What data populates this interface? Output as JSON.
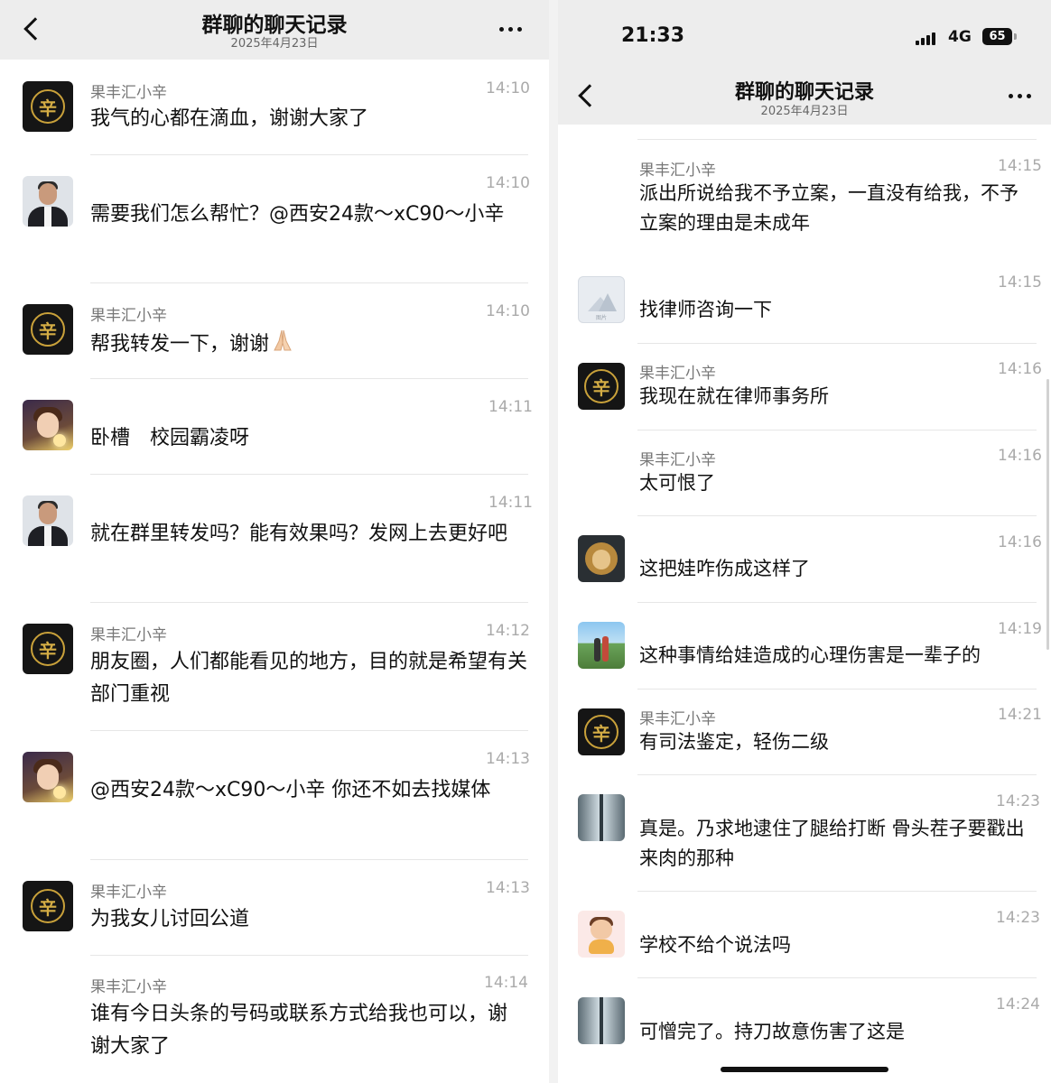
{
  "left": {
    "title": "群聊的聊天记录",
    "date": "2025年4月23日",
    "messages": [
      {
        "avatar": "logo",
        "sender": "果丰汇小辛",
        "time": "14:10",
        "text": "我气的心都在滴血，谢谢大家了"
      },
      {
        "avatar": "man",
        "sender": "",
        "time": "14:10",
        "text": "需要我们怎么帮忙？@西安24款～xC90～小辛"
      },
      {
        "avatar": "logo",
        "sender": "果丰汇小辛",
        "time": "14:10",
        "text": "帮我转发一下，谢谢"
      },
      {
        "avatar": "anime",
        "sender": "",
        "time": "14:11",
        "text": "卧槽　校园霸凌呀"
      },
      {
        "avatar": "man",
        "sender": "",
        "time": "14:11",
        "text": "就在群里转发吗？能有效果吗？发网上去更好吧"
      },
      {
        "avatar": "logo",
        "sender": "果丰汇小辛",
        "time": "14:12",
        "text": "朋友圈，人们都能看见的地方，目的就是希望有关部门重视"
      },
      {
        "avatar": "anime",
        "sender": "",
        "time": "14:13",
        "text": "@西安24款～xC90～小辛 你还不如去找媒体"
      },
      {
        "avatar": "logo",
        "sender": "果丰汇小辛",
        "time": "14:13",
        "text": "为我女儿讨回公道"
      },
      {
        "avatar": "none",
        "sender": "果丰汇小辛",
        "time": "14:14",
        "text": "谁有今日头条的号码或联系方式给我也可以，谢谢大家了"
      }
    ]
  },
  "right": {
    "status": {
      "time": "21:33",
      "network": "4G",
      "battery": "65"
    },
    "title": "群聊的聊天记录",
    "date": "2025年4月23日",
    "messages": [
      {
        "avatar": "none",
        "sender": "果丰汇小辛",
        "time": "14:15",
        "text": "派出所说给我不予立案，一直没有给我，不予立案的理由是未成年"
      },
      {
        "avatar": "placeholder",
        "sender": "",
        "time": "14:15",
        "text": "找律师咨询一下"
      },
      {
        "avatar": "logo",
        "sender": "果丰汇小辛",
        "time": "14:16",
        "text": "我现在就在律师事务所"
      },
      {
        "avatar": "none",
        "sender": "果丰汇小辛",
        "time": "14:16",
        "text": "太可恨了"
      },
      {
        "avatar": "lion",
        "sender": "",
        "time": "14:16",
        "text": "这把娃咋伤成这样了"
      },
      {
        "avatar": "beach",
        "sender": "",
        "time": "14:19",
        "text": "这种事情给娃造成的心理伤害是一辈子的"
      },
      {
        "avatar": "logo",
        "sender": "果丰汇小辛",
        "time": "14:21",
        "text": "有司法鉴定，轻伤二级"
      },
      {
        "avatar": "glass",
        "sender": "",
        "time": "14:23",
        "text": "真是。乃求地逮住了腿给打断 骨头茬子要戳出来肉的那种"
      },
      {
        "avatar": "cartoon",
        "sender": "",
        "time": "14:23",
        "text": "学校不给个说法吗"
      },
      {
        "avatar": "glass",
        "sender": "",
        "time": "14:24",
        "text": "可憎完了。持刀故意伤害了这是"
      }
    ]
  },
  "icons": {
    "back": "chevron-left-icon",
    "more": "more-dots-icon",
    "pray": "praying-hands-emoji"
  },
  "colors": {
    "nav_bg": "#ededed",
    "text": "#111111",
    "meta": "#aaaaaa",
    "separator": "#e6e6e6"
  }
}
